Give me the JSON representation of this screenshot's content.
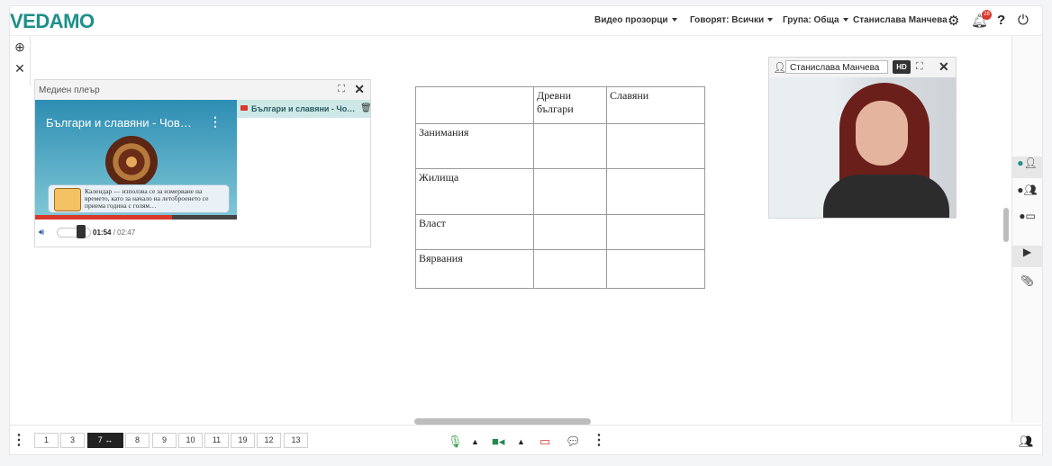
{
  "header": {
    "logo": "VEDAMO",
    "menu_video": "Видео прозорци",
    "menu_speak": "Говорят: Всички",
    "menu_group": "Група: Обща",
    "user_name": "Станислава Манчева",
    "notification_count": "28",
    "icons": [
      "gear-icon",
      "bell-icon",
      "help-icon",
      "power-icon"
    ]
  },
  "media_player": {
    "title": "Медиен плеър",
    "video_title": "Българи и славяни - Чов…",
    "caption": "Календар — използва се за измерване на времето, като за начало на летоброенето се приема година с голям…",
    "current_time": "01:54",
    "total_time": "/ 02:47",
    "progress_fraction": 0.68,
    "volume_fraction": 0.75,
    "playlist_item": "Българи и славяни - Чо…"
  },
  "whiteboard_table": {
    "header": [
      "",
      "Древни българи",
      "Славяни"
    ],
    "rows": [
      [
        "Занимания",
        "",
        ""
      ],
      [
        "Жилища",
        "",
        ""
      ],
      [
        "Власт",
        "",
        ""
      ],
      [
        "Вярвания",
        "",
        ""
      ]
    ]
  },
  "webcam": {
    "user": "Станислава Манчева",
    "quality": "HD"
  },
  "pagination": {
    "pages": [
      "1",
      "3",
      "7",
      "8",
      "9",
      "10",
      "11",
      "19",
      "12",
      "13"
    ],
    "active": "7"
  },
  "colors": {
    "brand": "#1e8f8a",
    "mic": "#3aa14a",
    "camera": "#1f8a4c",
    "screen_share": "#d9382c",
    "badge": "#d9382c"
  }
}
